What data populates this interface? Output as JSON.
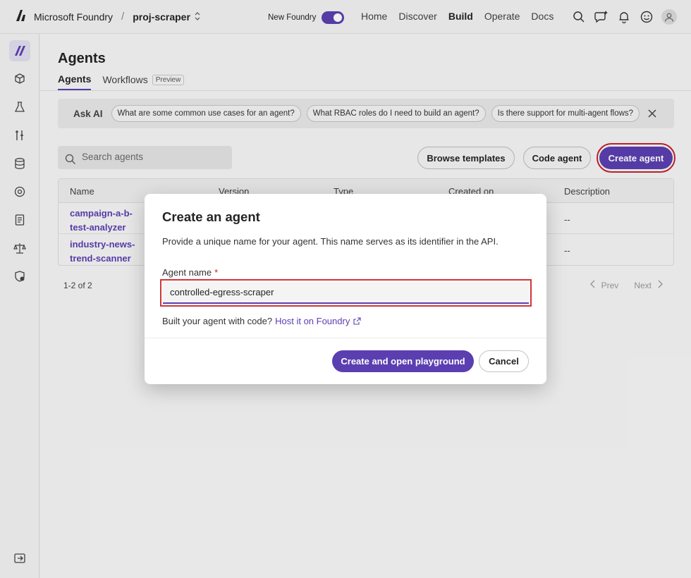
{
  "topbar": {
    "brand": "Microsoft Foundry",
    "separator": "/",
    "project": "proj-scraper",
    "new_foundry_label": "New Foundry",
    "nav": [
      "Home",
      "Discover",
      "Build",
      "Operate",
      "Docs"
    ],
    "active_nav": "Build",
    "icons": [
      "search-icon",
      "copilot-icon",
      "bell-icon",
      "smiley-icon",
      "user-icon"
    ]
  },
  "sidebar": {
    "items": [
      "agents-icon",
      "models-icon",
      "evaluation-icon",
      "tools-icon",
      "data-icon",
      "guardrails-icon",
      "documents-icon",
      "compliance-icon",
      "security-icon"
    ],
    "collapse": "collapse-icon"
  },
  "page": {
    "title": "Agents",
    "tabs": [
      {
        "label": "Agents"
      },
      {
        "label": "Workflows",
        "badge": "Preview"
      }
    ]
  },
  "ask_ai": {
    "label": "Ask AI",
    "suggestions": [
      "What are some common use cases for an agent?",
      "What RBAC roles do I need to build an agent?",
      "Is there support for multi-agent flows?"
    ]
  },
  "toolbar": {
    "search_placeholder": "Search agents",
    "browse_templates": "Browse templates",
    "code_agent": "Code agent",
    "create_agent": "Create agent"
  },
  "table": {
    "columns": [
      "Name",
      "Version",
      "Type",
      "Created on",
      "Description"
    ],
    "rows": [
      {
        "name": "campaign-a-b-test-analyzer",
        "description": "--"
      },
      {
        "name": "industry-news-trend-scanner",
        "description": "--"
      }
    ],
    "paging": "1-2 of 2",
    "prev": "Prev",
    "next": "Next"
  },
  "modal": {
    "title": "Create an agent",
    "description": "Provide a unique name for your agent. This name serves as its identifier in the API.",
    "field_label": "Agent name",
    "required_mark": "*",
    "field_value": "controlled-egress-scraper",
    "hint_text": "Built your agent with code?",
    "hint_link": "Host it on Foundry",
    "primary": "Create and open playground",
    "cancel": "Cancel"
  },
  "colors": {
    "accent": "#5b3fb1",
    "highlight": "#d13438"
  }
}
